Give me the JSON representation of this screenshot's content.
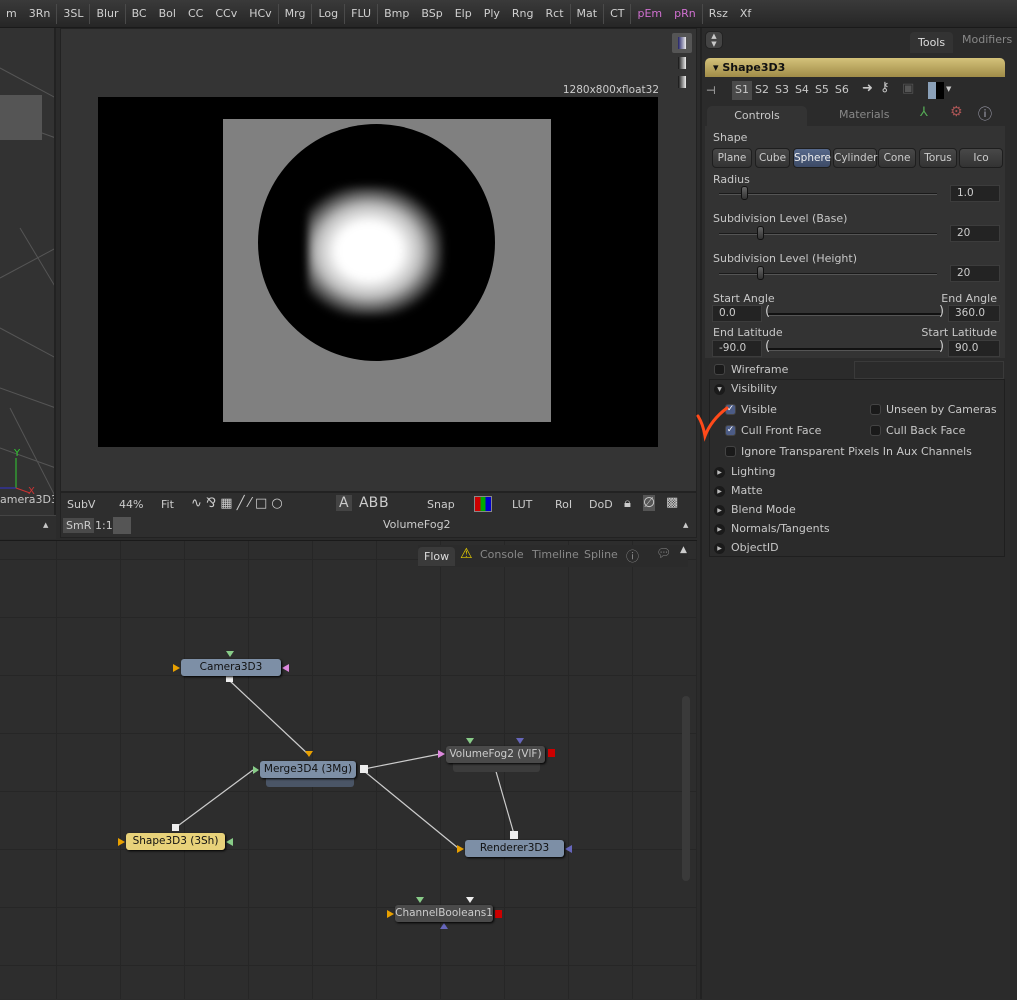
{
  "toolbar": {
    "items": [
      {
        "label": "m",
        "pink": false
      },
      {
        "label": "3Rn",
        "pink": false
      },
      {
        "label": "3SL",
        "pink": false,
        "sep": true
      },
      {
        "label": "Blur",
        "pink": false,
        "sep": true
      },
      {
        "label": "BC",
        "pink": false,
        "sep": true
      },
      {
        "label": "Bol",
        "pink": false
      },
      {
        "label": "CC",
        "pink": false
      },
      {
        "label": "CCv",
        "pink": false
      },
      {
        "label": "HCv",
        "pink": false
      },
      {
        "label": "Mrg",
        "pink": false,
        "sep": true
      },
      {
        "label": "Log",
        "pink": false,
        "sep": true
      },
      {
        "label": "FLU",
        "pink": false,
        "sep": true
      },
      {
        "label": "Bmp",
        "pink": false,
        "sep": true
      },
      {
        "label": "BSp",
        "pink": false
      },
      {
        "label": "Elp",
        "pink": false
      },
      {
        "label": "Ply",
        "pink": false
      },
      {
        "label": "Rng",
        "pink": false
      },
      {
        "label": "Rct",
        "pink": false
      },
      {
        "label": "Mat",
        "pink": false,
        "sep": true
      },
      {
        "label": "CT",
        "pink": false,
        "sep": true
      },
      {
        "label": "pEm",
        "pink": true,
        "sep": true
      },
      {
        "label": "pRn",
        "pink": true
      },
      {
        "label": "Rsz",
        "pink": false,
        "sep": true
      },
      {
        "label": "Xf",
        "pink": false
      }
    ]
  },
  "left_viewer": {
    "label": "amera3D3",
    "axis_y": "Y",
    "axis_x": "X"
  },
  "viewer": {
    "resolution": "1280x800xfloat32",
    "node_name": "VolumeFog2",
    "toolbar": {
      "subv": "SubV",
      "zoom": "44%",
      "fit": "Fit",
      "a": "A",
      "ab": "AB",
      "b": "B",
      "snap": "Snap",
      "lut": "LUT",
      "roi": "RoI",
      "dod": "DoD",
      "smr": "SmR",
      "one_to_one": "1:1"
    }
  },
  "flow": {
    "tabs": [
      "Flow",
      "Console",
      "Timeline",
      "Spline"
    ],
    "nodes": {
      "camera": "Camera3D3",
      "merge": "Merge3D4  (3Mg)",
      "fog": "VolumeFog2  (VlF)",
      "shape": "Shape3D3  (3Sh)",
      "renderer": "Renderer3D3",
      "booleans": "ChannelBooleans1"
    }
  },
  "panel": {
    "tabs": {
      "tools": "Tools",
      "modifiers": "Modifiers"
    },
    "tool_name": "Shape3D3",
    "slots": [
      "S1",
      "S2",
      "S3",
      "S4",
      "S5",
      "S6"
    ],
    "subtabs": {
      "controls": "Controls",
      "materials": "Materials"
    },
    "shape_label": "Shape",
    "shapes": [
      "Plane",
      "Cube",
      "Sphere",
      "Cylinder",
      "Cone",
      "Torus",
      "Ico"
    ],
    "selected_shape": "Sphere",
    "radius": {
      "label": "Radius",
      "value": "1.0"
    },
    "subdiv_base": {
      "label": "Subdivision Level (Base)",
      "value": "20"
    },
    "subdiv_height": {
      "label": "Subdivision Level (Height)",
      "value": "20"
    },
    "start_angle": {
      "label": "Start Angle",
      "value": "0.0"
    },
    "end_angle": {
      "label": "End Angle",
      "value": "360.0"
    },
    "end_latitude": {
      "label": "End Latitude",
      "value": "-90.0"
    },
    "start_latitude": {
      "label": "Start Latitude",
      "value": "90.0"
    },
    "wireframe": "Wireframe",
    "visibility": "Visibility",
    "visible": "Visible",
    "unseen": "Unseen by Cameras",
    "cull_front": "Cull Front Face",
    "cull_back": "Cull Back Face",
    "ignore_transparent": "Ignore Transparent Pixels In Aux Channels",
    "sections": [
      "Lighting",
      "Matte",
      "Blend Mode",
      "Normals/Tangents",
      "ObjectID"
    ]
  },
  "colors": {
    "header_gold": "#c8b46a",
    "node_blue": "#7d8fa6",
    "node_yellow": "#e8d27a",
    "annotation": "#ff4a1a"
  }
}
